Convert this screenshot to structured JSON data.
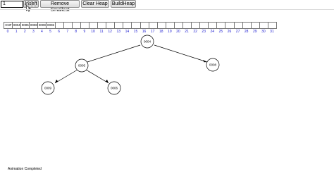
{
  "toolbar": {
    "input_value": "1",
    "buttons": {
      "insert": "Insert",
      "remove_smallest": "Remove Smallest",
      "clear_heap": "Clear Heap",
      "build_heap": "BuildHeap"
    }
  },
  "array": {
    "cells": [
      "<INF",
      "0004",
      "0005",
      "0008",
      "0009",
      "0006",
      "",
      "",
      "",
      "",
      "",
      "",
      "",
      "",
      "",
      "",
      "",
      "",
      "",
      "",
      "",
      "",
      "",
      "",
      "",
      "",
      "",
      "",
      "",
      "",
      "",
      ""
    ],
    "indices": [
      "0",
      "1",
      "2",
      "3",
      "4",
      "5",
      "6",
      "7",
      "8",
      "9",
      "10",
      "11",
      "12",
      "13",
      "14",
      "15",
      "16",
      "17",
      "18",
      "19",
      "20",
      "21",
      "22",
      "23",
      "24",
      "25",
      "26",
      "27",
      "28",
      "29",
      "30",
      "31"
    ]
  },
  "tree": {
    "nodes": [
      "0004",
      "0005",
      "0008",
      "0009",
      "0006"
    ]
  },
  "status": "Animation Completed",
  "colors": {
    "index_text": "#1a1ad0",
    "node_stroke": "#000000",
    "cell_border": "#777777"
  }
}
